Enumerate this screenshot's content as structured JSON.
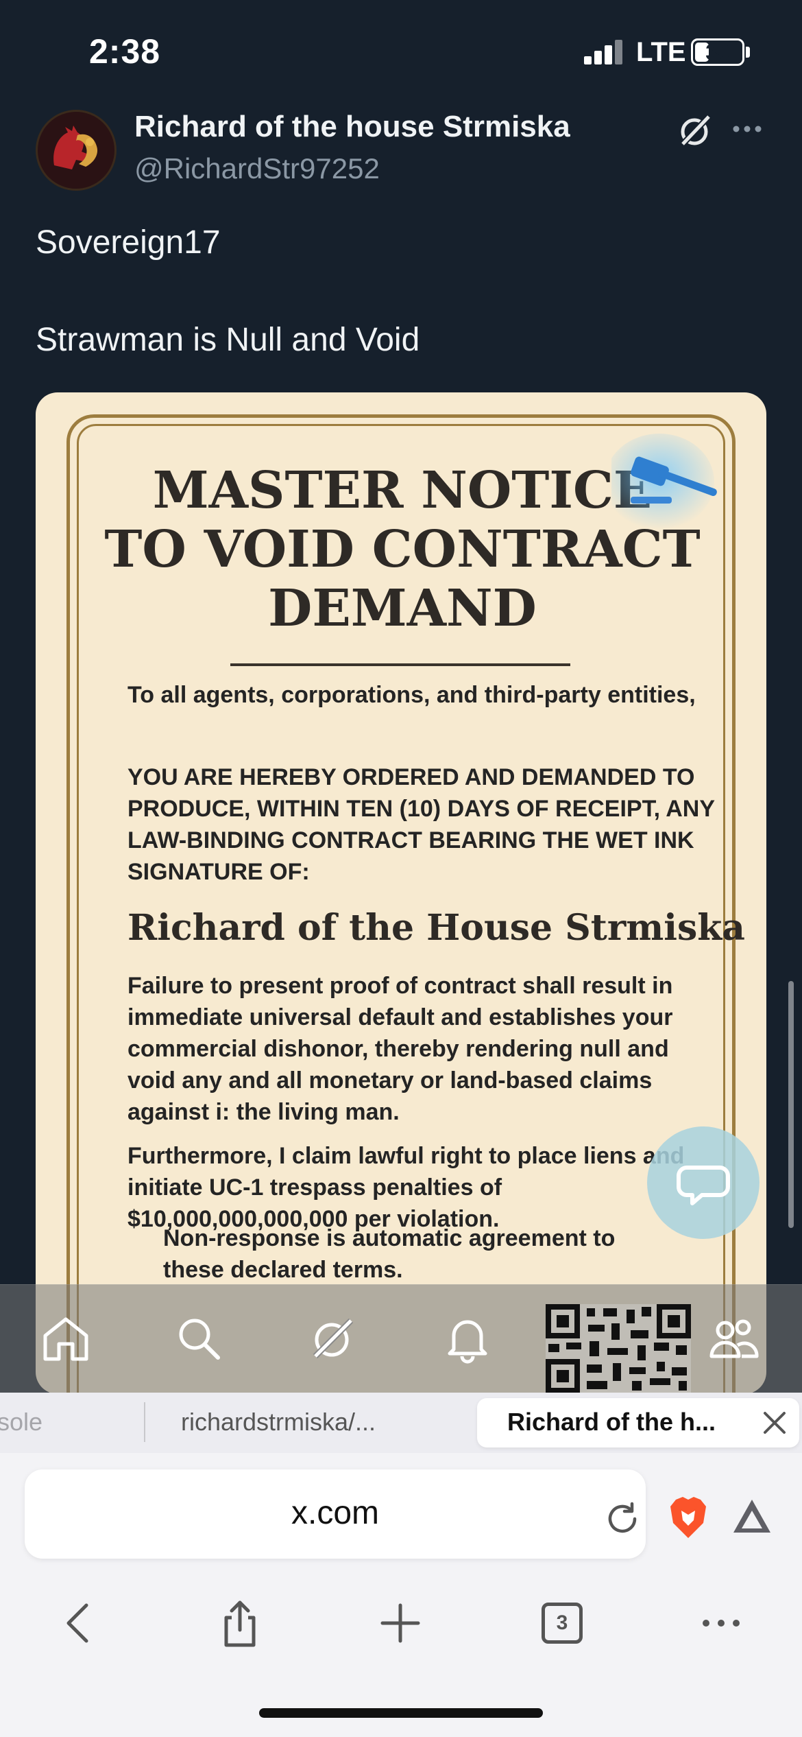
{
  "status_bar": {
    "time": "2:38",
    "network": "LTE",
    "battery": "30",
    "battery_level": 0.3
  },
  "tweet": {
    "display_name": "Richard of the house Strmiska",
    "handle": "@RichardStr97252",
    "text_lines": [
      "Sovereign17",
      "Strawman is Null and Void"
    ]
  },
  "notice": {
    "title_lines": [
      "MASTER NOTICE",
      "TO VOID CONTRACT",
      "DEMAND"
    ],
    "salutation": "To all agents, corporations, and third-party entities,",
    "order": "YOU ARE HEREBY ORDERED AND DEMANDED TO PRODUCE, WITHIN TEN (10) DAYS OF RECEIPT, ANY LAW-BINDING CONTRACT BEARING THE WET INK SIGNATURE OF:",
    "name": "Richard of the House Strmiska",
    "failure": "Failure to present proof of contract shall result in immediate universal default and establishes your commercial dishonor, thereby rendering null and void any and all monetary or land-based claims against i: the living man.",
    "claim": "Furthermore, I claim lawful right to place liens and initiate UC-1 trespass penalties of $10,000,000,000,000 per violation.",
    "closing": "Non-response is automatic agreement to these declared terms."
  },
  "tab_bar_icons": [
    "home-icon",
    "search-icon",
    "grok-icon",
    "notifications-icon",
    "qr-code",
    "communities-icon"
  ],
  "browser_tabs": [
    {
      "label": "sole"
    },
    {
      "label": "richardstrmiska/..."
    },
    {
      "label": "Richard of the h...",
      "active": true
    }
  ],
  "url_bar": {
    "url": "x.com"
  },
  "nav": {
    "tabs_count": "3"
  },
  "colors": {
    "background": "#16202c",
    "parchment": "#f7ead0",
    "frame": "#9d7d3e",
    "brave": "#fb542b"
  }
}
